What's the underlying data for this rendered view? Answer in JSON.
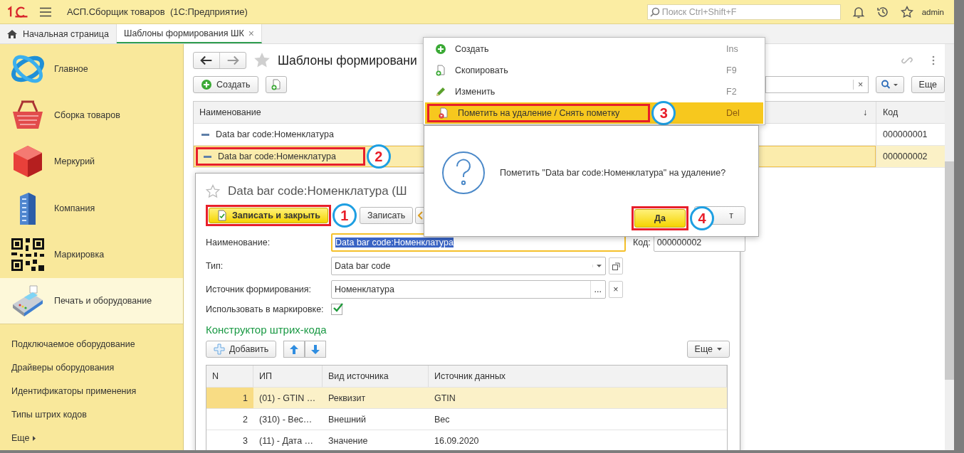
{
  "window": {
    "title": "АСП.Сборщик товаров  (1С:Предприятие)",
    "search_placeholder": "Поиск Ctrl+Shift+F",
    "user": "admin"
  },
  "tabs": [
    {
      "label": "Начальная страница",
      "kind": "home",
      "selected": false
    },
    {
      "label": "Шаблоны формирования ШК",
      "kind": "page",
      "selected": true,
      "close": "×"
    }
  ],
  "sidebar": {
    "sections": [
      {
        "label": "Главное",
        "selected": false
      },
      {
        "label": "Сборка товаров",
        "selected": false
      },
      {
        "label": "Меркурий",
        "selected": false
      },
      {
        "label": "Компания",
        "selected": false
      },
      {
        "label": "Маркировка",
        "selected": false
      },
      {
        "label": "Печать и оборудование",
        "selected": true
      }
    ],
    "links": [
      "Подключаемое оборудование",
      "Драйверы оборудования",
      "Идентификаторы применения",
      "Типы штрих кодов"
    ],
    "more": "Еще"
  },
  "list": {
    "title": "Шаблоны формировани",
    "create": "Создать",
    "search_clear": "×",
    "more": "Еще",
    "columns": [
      "Наименование",
      "Код"
    ],
    "sort_mark": "↓",
    "rows": [
      {
        "name": "Data bar code:Номенклатура",
        "code": "000000001",
        "selected": false
      },
      {
        "name": "Data bar code:Номенклатура",
        "code": "000000002",
        "selected": true,
        "callout": "2"
      }
    ]
  },
  "form": {
    "title": "Data bar code:Номенклатура (Ш",
    "buttons": [
      {
        "label": "Записать и закрыть",
        "default": true,
        "callout": "1"
      },
      {
        "label": "Записать",
        "default": false
      }
    ],
    "name_label": "Наименование:",
    "name_value": "Data bar code:Номенклатура",
    "code_label": "Код:",
    "code_value": "000000002",
    "type_label": "Тип:",
    "type_value": "Data bar code",
    "source_label": "Источник формирования:",
    "source_value": "Номенклатура",
    "source_more": "...",
    "source_clear": "×",
    "use_label": "Использовать в маркировке:",
    "use_checked": true,
    "section_title": "Конструктор штрих-кода",
    "add": "Добавить",
    "more": "Еще",
    "columns": [
      "N",
      "ИП",
      "Вид источника",
      "Источник данных"
    ],
    "rows": [
      {
        "n": "1",
        "ip": "(01) - GTIN …",
        "source_kind": "Реквизит",
        "data": "GTIN",
        "selected": true
      },
      {
        "n": "2",
        "ip": "(310) - Вес…",
        "source_kind": "Внешний",
        "data": "Вес",
        "selected": false
      },
      {
        "n": "3",
        "ip": "(11) - Дата …",
        "source_kind": "Значение",
        "data": "16.09.2020",
        "selected": false
      }
    ]
  },
  "menu": {
    "items": [
      {
        "label": "Создать",
        "shortcut": "Ins",
        "selected": false
      },
      {
        "label": "Скопировать",
        "shortcut": "F9",
        "selected": false
      },
      {
        "label": "Изменить",
        "shortcut": "F2",
        "selected": false
      },
      {
        "label": "Пометить на удаление / Снять пометку",
        "shortcut": "Del",
        "selected": true,
        "callout": "3"
      }
    ]
  },
  "dialog": {
    "message": "Пометить \"Data bar code:Номенклатура\" на удаление?",
    "buttons": [
      {
        "label": "Да",
        "default": true,
        "callout": "4"
      },
      {
        "label": "т",
        "default": false
      }
    ]
  }
}
